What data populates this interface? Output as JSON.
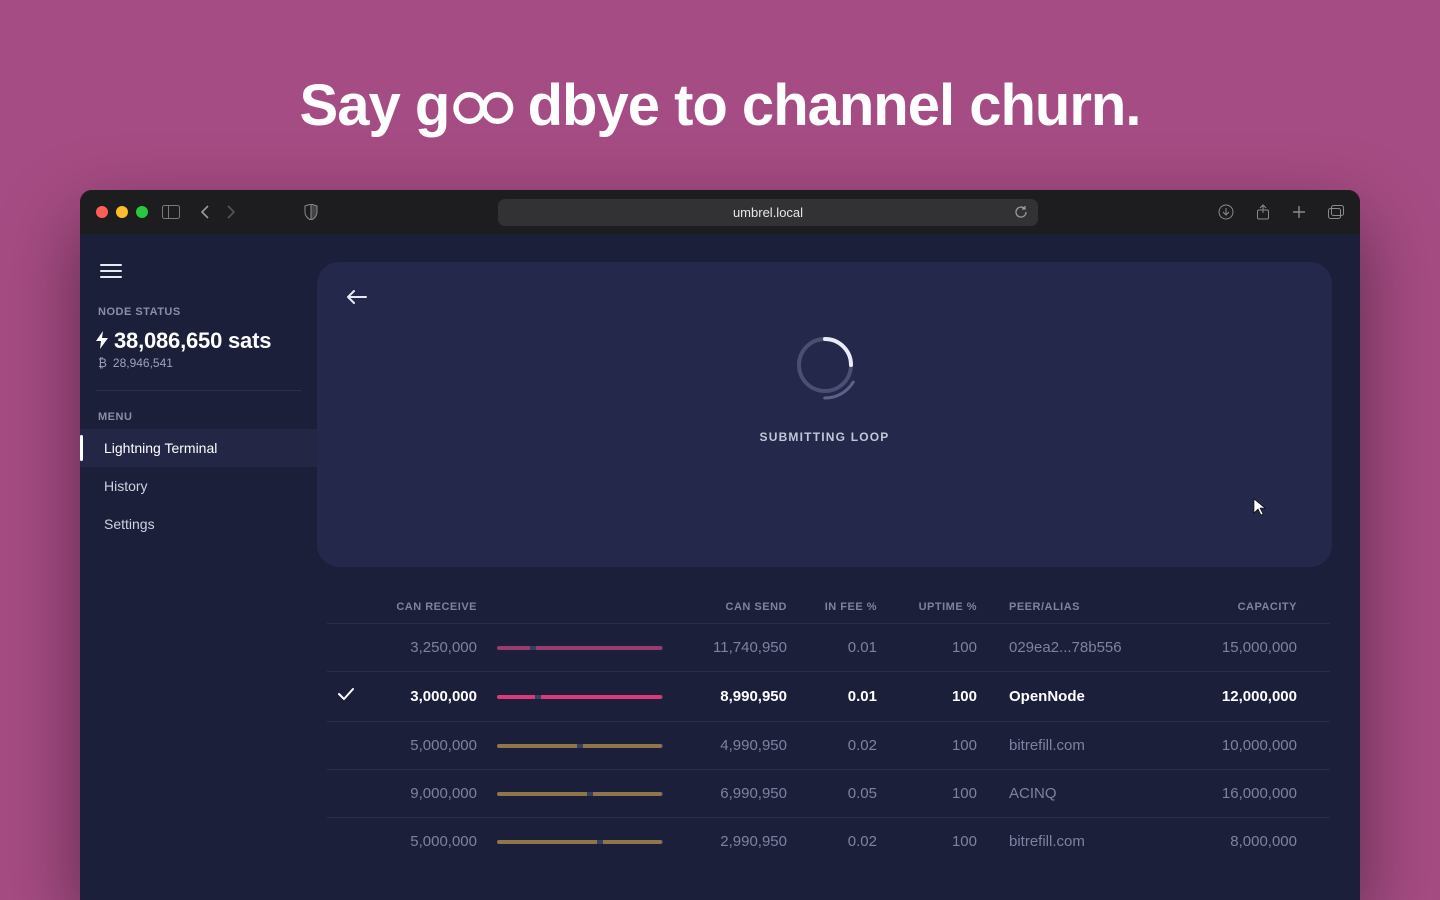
{
  "headline": {
    "pre": "Say g",
    "post": "dbye to channel churn."
  },
  "browser": {
    "url": "umbrel.local"
  },
  "sidebar": {
    "node_status_label": "NODE STATUS",
    "balance_main": "38,086,650 sats",
    "balance_sub": "28,946,541",
    "menu_label": "MENU",
    "items": [
      {
        "label": "Lightning Terminal",
        "active": true
      },
      {
        "label": "History",
        "active": false
      },
      {
        "label": "Settings",
        "active": false
      }
    ]
  },
  "card": {
    "status_label": "SUBMITTING LOOP"
  },
  "table": {
    "headers": {
      "can_receive": "CAN RECEIVE",
      "can_send": "CAN SEND",
      "in_fee": "IN FEE %",
      "uptime": "UPTIME %",
      "peer": "PEER/ALIAS",
      "capacity": "CAPACITY"
    },
    "rows": [
      {
        "checked": false,
        "can_receive": "3,250,000",
        "can_send": "11,740,950",
        "in_fee": "0.01",
        "uptime": "100",
        "peer": "029ea2...78b556",
        "capacity": "15,000,000",
        "bar_color": "pink",
        "recv_frac": 0.22,
        "active": false
      },
      {
        "checked": true,
        "can_receive": "3,000,000",
        "can_send": "8,990,950",
        "in_fee": "0.01",
        "uptime": "100",
        "peer": "OpenNode",
        "capacity": "12,000,000",
        "bar_color": "pink",
        "recv_frac": 0.25,
        "active": true
      },
      {
        "checked": false,
        "can_receive": "5,000,000",
        "can_send": "4,990,950",
        "in_fee": "0.02",
        "uptime": "100",
        "peer": "bitrefill.com",
        "capacity": "10,000,000",
        "bar_color": "gold",
        "recv_frac": 0.5,
        "active": false
      },
      {
        "checked": false,
        "can_receive": "9,000,000",
        "can_send": "6,990,950",
        "in_fee": "0.05",
        "uptime": "100",
        "peer": "ACINQ",
        "capacity": "16,000,000",
        "bar_color": "gold",
        "recv_frac": 0.56,
        "active": false
      },
      {
        "checked": false,
        "can_receive": "5,000,000",
        "can_send": "2,990,950",
        "in_fee": "0.02",
        "uptime": "100",
        "peer": "bitrefill.com",
        "capacity": "8,000,000",
        "bar_color": "gold",
        "recv_frac": 0.62,
        "active": false
      }
    ]
  }
}
